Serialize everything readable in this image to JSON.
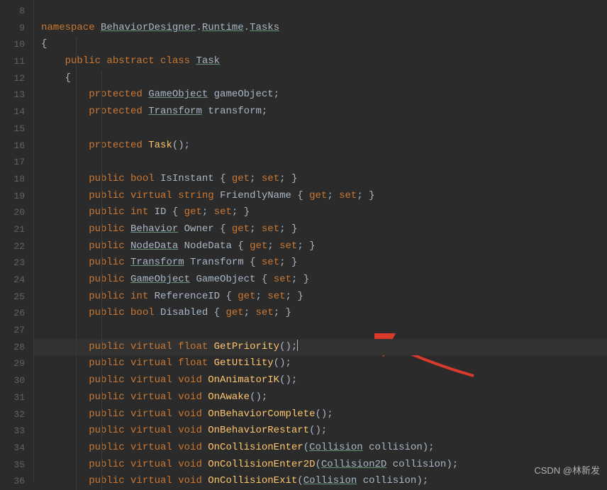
{
  "startLine": 8,
  "highlightedLine": 28,
  "watermark": "CSDN @林新发",
  "lines": [
    {
      "n": 8,
      "tokens": []
    },
    {
      "n": 9,
      "tokens": [
        {
          "t": "namespace ",
          "c": "kw"
        },
        {
          "t": "BehaviorDesigner",
          "c": "cls under"
        },
        {
          "t": ".",
          "c": "punct"
        },
        {
          "t": "Runtime",
          "c": "cls under"
        },
        {
          "t": ".",
          "c": "punct"
        },
        {
          "t": "Tasks",
          "c": "cls under"
        }
      ]
    },
    {
      "n": 10,
      "tokens": [
        {
          "t": "{",
          "c": "brace"
        }
      ]
    },
    {
      "n": 11,
      "tokens": [
        {
          "t": "    ",
          "c": ""
        },
        {
          "t": "public abstract class ",
          "c": "kw"
        },
        {
          "t": "Task",
          "c": "cls under"
        }
      ]
    },
    {
      "n": 12,
      "tokens": [
        {
          "t": "    ",
          "c": ""
        },
        {
          "t": "{",
          "c": "brace"
        }
      ]
    },
    {
      "n": 13,
      "tokens": [
        {
          "t": "        ",
          "c": ""
        },
        {
          "t": "protected ",
          "c": "kw"
        },
        {
          "t": "GameObject",
          "c": "cls under"
        },
        {
          "t": " gameObject",
          "c": "ident"
        },
        {
          "t": ";",
          "c": "punct"
        }
      ]
    },
    {
      "n": 14,
      "tokens": [
        {
          "t": "        ",
          "c": ""
        },
        {
          "t": "protected ",
          "c": "kw"
        },
        {
          "t": "Transform",
          "c": "cls under"
        },
        {
          "t": " transform",
          "c": "ident"
        },
        {
          "t": ";",
          "c": "punct"
        }
      ]
    },
    {
      "n": 15,
      "tokens": []
    },
    {
      "n": 16,
      "tokens": [
        {
          "t": "        ",
          "c": ""
        },
        {
          "t": "protected ",
          "c": "kw"
        },
        {
          "t": "Task",
          "c": "method"
        },
        {
          "t": "();",
          "c": "punct"
        }
      ]
    },
    {
      "n": 17,
      "tokens": []
    },
    {
      "n": 18,
      "tokens": [
        {
          "t": "        ",
          "c": ""
        },
        {
          "t": "public bool ",
          "c": "kw"
        },
        {
          "t": "IsInstant ",
          "c": "ident"
        },
        {
          "t": "{ ",
          "c": "brace"
        },
        {
          "t": "get",
          "c": "kw"
        },
        {
          "t": "; ",
          "c": "punct"
        },
        {
          "t": "set",
          "c": "kw"
        },
        {
          "t": "; ",
          "c": "punct"
        },
        {
          "t": "}",
          "c": "brace"
        }
      ]
    },
    {
      "n": 19,
      "tokens": [
        {
          "t": "        ",
          "c": ""
        },
        {
          "t": "public virtual string ",
          "c": "kw"
        },
        {
          "t": "FriendlyName ",
          "c": "ident"
        },
        {
          "t": "{ ",
          "c": "brace"
        },
        {
          "t": "get",
          "c": "kw"
        },
        {
          "t": "; ",
          "c": "punct"
        },
        {
          "t": "set",
          "c": "kw"
        },
        {
          "t": "; ",
          "c": "punct"
        },
        {
          "t": "}",
          "c": "brace"
        }
      ]
    },
    {
      "n": 20,
      "tokens": [
        {
          "t": "        ",
          "c": ""
        },
        {
          "t": "public int ",
          "c": "kw"
        },
        {
          "t": "ID ",
          "c": "ident"
        },
        {
          "t": "{ ",
          "c": "brace"
        },
        {
          "t": "get",
          "c": "kw"
        },
        {
          "t": "; ",
          "c": "punct"
        },
        {
          "t": "set",
          "c": "kw"
        },
        {
          "t": "; ",
          "c": "punct"
        },
        {
          "t": "}",
          "c": "brace"
        }
      ]
    },
    {
      "n": 21,
      "tokens": [
        {
          "t": "        ",
          "c": ""
        },
        {
          "t": "public ",
          "c": "kw"
        },
        {
          "t": "Behavior",
          "c": "cls under"
        },
        {
          "t": " Owner ",
          "c": "ident"
        },
        {
          "t": "{ ",
          "c": "brace"
        },
        {
          "t": "get",
          "c": "kw"
        },
        {
          "t": "; ",
          "c": "punct"
        },
        {
          "t": "set",
          "c": "kw"
        },
        {
          "t": "; ",
          "c": "punct"
        },
        {
          "t": "}",
          "c": "brace"
        }
      ]
    },
    {
      "n": 22,
      "tokens": [
        {
          "t": "        ",
          "c": ""
        },
        {
          "t": "public ",
          "c": "kw"
        },
        {
          "t": "NodeData",
          "c": "cls under"
        },
        {
          "t": " NodeData ",
          "c": "ident"
        },
        {
          "t": "{ ",
          "c": "brace"
        },
        {
          "t": "get",
          "c": "kw"
        },
        {
          "t": "; ",
          "c": "punct"
        },
        {
          "t": "set",
          "c": "kw"
        },
        {
          "t": "; ",
          "c": "punct"
        },
        {
          "t": "}",
          "c": "brace"
        }
      ]
    },
    {
      "n": 23,
      "tokens": [
        {
          "t": "        ",
          "c": ""
        },
        {
          "t": "public ",
          "c": "kw"
        },
        {
          "t": "Transform",
          "c": "cls under"
        },
        {
          "t": " Transform ",
          "c": "ident"
        },
        {
          "t": "{ ",
          "c": "brace"
        },
        {
          "t": "set",
          "c": "kw"
        },
        {
          "t": "; ",
          "c": "punct"
        },
        {
          "t": "}",
          "c": "brace"
        }
      ]
    },
    {
      "n": 24,
      "tokens": [
        {
          "t": "        ",
          "c": ""
        },
        {
          "t": "public ",
          "c": "kw"
        },
        {
          "t": "GameObject",
          "c": "cls under"
        },
        {
          "t": " GameObject ",
          "c": "ident"
        },
        {
          "t": "{ ",
          "c": "brace"
        },
        {
          "t": "set",
          "c": "kw"
        },
        {
          "t": "; ",
          "c": "punct"
        },
        {
          "t": "}",
          "c": "brace"
        }
      ]
    },
    {
      "n": 25,
      "tokens": [
        {
          "t": "        ",
          "c": ""
        },
        {
          "t": "public int ",
          "c": "kw"
        },
        {
          "t": "ReferenceID ",
          "c": "ident"
        },
        {
          "t": "{ ",
          "c": "brace"
        },
        {
          "t": "get",
          "c": "kw"
        },
        {
          "t": "; ",
          "c": "punct"
        },
        {
          "t": "set",
          "c": "kw"
        },
        {
          "t": "; ",
          "c": "punct"
        },
        {
          "t": "}",
          "c": "brace"
        }
      ]
    },
    {
      "n": 26,
      "tokens": [
        {
          "t": "        ",
          "c": ""
        },
        {
          "t": "public bool ",
          "c": "kw"
        },
        {
          "t": "Disabled ",
          "c": "ident"
        },
        {
          "t": "{ ",
          "c": "brace"
        },
        {
          "t": "get",
          "c": "kw"
        },
        {
          "t": "; ",
          "c": "punct"
        },
        {
          "t": "set",
          "c": "kw"
        },
        {
          "t": "; ",
          "c": "punct"
        },
        {
          "t": "}",
          "c": "brace"
        }
      ]
    },
    {
      "n": 27,
      "tokens": []
    },
    {
      "n": 28,
      "cursor": true,
      "tokens": [
        {
          "t": "        ",
          "c": ""
        },
        {
          "t": "public virtual float ",
          "c": "kw"
        },
        {
          "t": "GetPriority",
          "c": "method"
        },
        {
          "t": "();",
          "c": "punct"
        }
      ]
    },
    {
      "n": 29,
      "tokens": [
        {
          "t": "        ",
          "c": ""
        },
        {
          "t": "public virtual float ",
          "c": "kw"
        },
        {
          "t": "GetUtility",
          "c": "method"
        },
        {
          "t": "();",
          "c": "punct"
        }
      ]
    },
    {
      "n": 30,
      "tokens": [
        {
          "t": "        ",
          "c": ""
        },
        {
          "t": "public virtual void ",
          "c": "kw"
        },
        {
          "t": "OnAnimatorIK",
          "c": "method"
        },
        {
          "t": "();",
          "c": "punct"
        }
      ]
    },
    {
      "n": 31,
      "tokens": [
        {
          "t": "        ",
          "c": ""
        },
        {
          "t": "public virtual void ",
          "c": "kw"
        },
        {
          "t": "OnAwake",
          "c": "method"
        },
        {
          "t": "();",
          "c": "punct"
        }
      ]
    },
    {
      "n": 32,
      "tokens": [
        {
          "t": "        ",
          "c": ""
        },
        {
          "t": "public virtual void ",
          "c": "kw"
        },
        {
          "t": "OnBehaviorComplete",
          "c": "method"
        },
        {
          "t": "();",
          "c": "punct"
        }
      ]
    },
    {
      "n": 33,
      "tokens": [
        {
          "t": "        ",
          "c": ""
        },
        {
          "t": "public virtual void ",
          "c": "kw"
        },
        {
          "t": "OnBehaviorRestart",
          "c": "method"
        },
        {
          "t": "();",
          "c": "punct"
        }
      ]
    },
    {
      "n": 34,
      "tokens": [
        {
          "t": "        ",
          "c": ""
        },
        {
          "t": "public virtual void ",
          "c": "kw"
        },
        {
          "t": "OnCollisionEnter",
          "c": "method"
        },
        {
          "t": "(",
          "c": "punct"
        },
        {
          "t": "Collision",
          "c": "cls under"
        },
        {
          "t": " collision",
          "c": "ident"
        },
        {
          "t": ");",
          "c": "punct"
        }
      ]
    },
    {
      "n": 35,
      "tokens": [
        {
          "t": "        ",
          "c": ""
        },
        {
          "t": "public virtual void ",
          "c": "kw"
        },
        {
          "t": "OnCollisionEnter2D",
          "c": "method"
        },
        {
          "t": "(",
          "c": "punct"
        },
        {
          "t": "Collision2D",
          "c": "cls under"
        },
        {
          "t": " collision",
          "c": "ident"
        },
        {
          "t": ");",
          "c": "punct"
        }
      ]
    },
    {
      "n": 36,
      "tokens": [
        {
          "t": "        ",
          "c": ""
        },
        {
          "t": "public virtual void ",
          "c": "kw"
        },
        {
          "t": "OnCollisionExit",
          "c": "method"
        },
        {
          "t": "(",
          "c": "punct"
        },
        {
          "t": "Collision",
          "c": "cls under"
        },
        {
          "t": " collision",
          "c": "ident"
        },
        {
          "t": ");",
          "c": "punct"
        }
      ]
    }
  ]
}
